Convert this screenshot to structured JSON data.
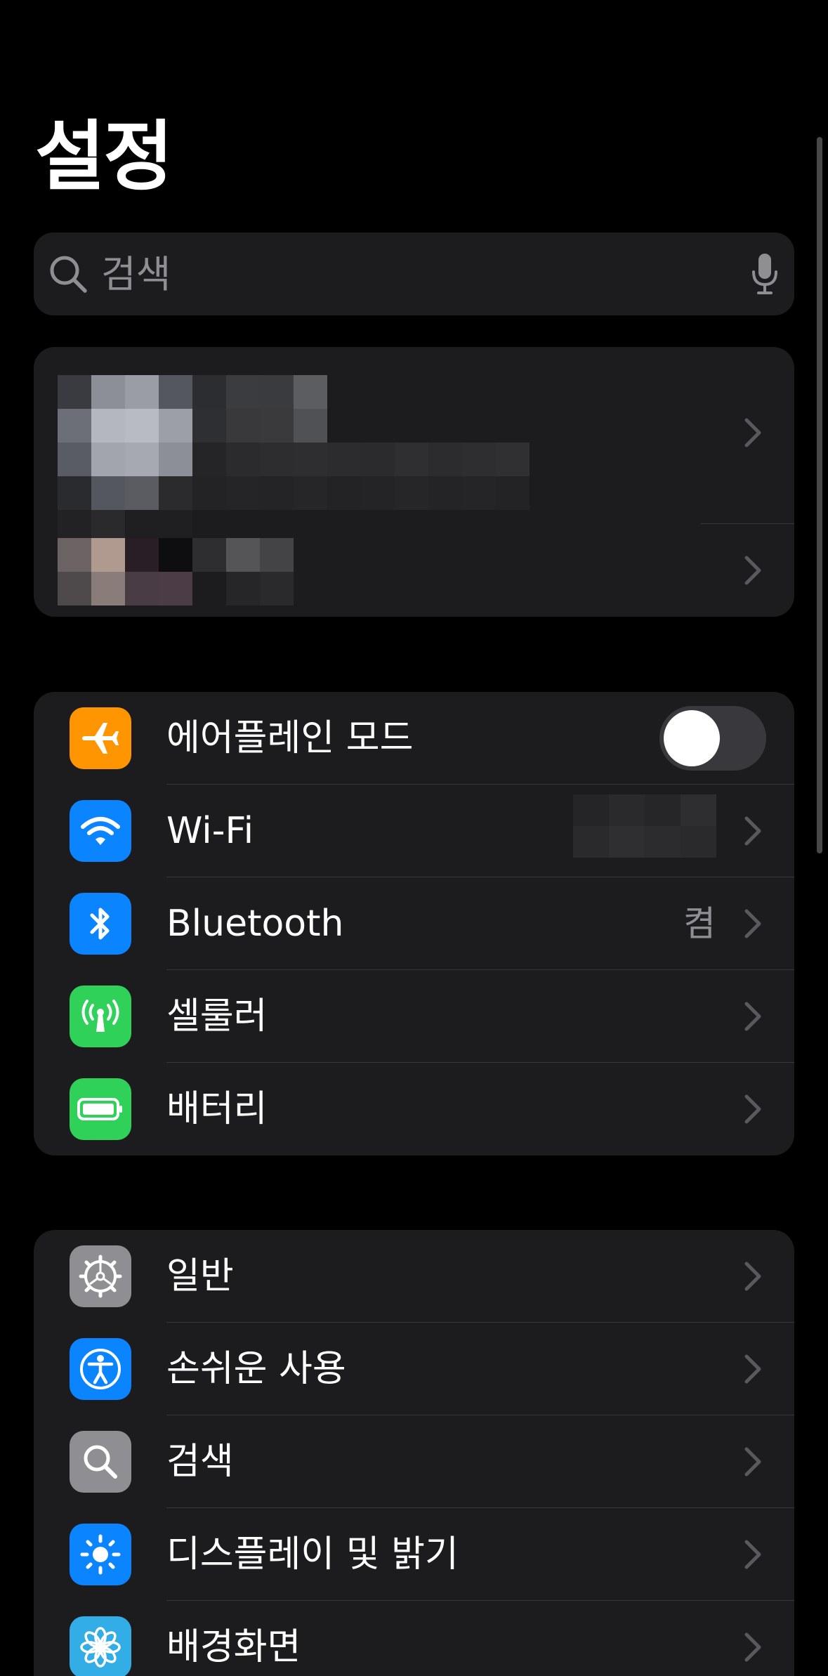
{
  "page": {
    "title": "설정"
  },
  "search": {
    "placeholder": "검색",
    "icon": "search-icon",
    "mic_icon": "microphone-icon"
  },
  "connectivity": {
    "items": [
      {
        "label": "에어플레인 모드",
        "icon": "airplane-icon",
        "icon_color": "#ff9500",
        "control": "toggle",
        "toggle_on": false
      },
      {
        "label": "Wi-Fi",
        "icon": "wifi-icon",
        "icon_color": "#0a84ff",
        "value_redacted": true
      },
      {
        "label": "Bluetooth",
        "icon": "bluetooth-icon",
        "icon_color": "#0a84ff",
        "value": "켬"
      },
      {
        "label": "셀룰러",
        "icon": "cellular-icon",
        "icon_color": "#30d158"
      },
      {
        "label": "배터리",
        "icon": "battery-icon",
        "icon_color": "#30d158"
      }
    ]
  },
  "general": {
    "items": [
      {
        "label": "일반",
        "icon": "gear-icon",
        "icon_color": "#8e8e93"
      },
      {
        "label": "손쉬운 사용",
        "icon": "accessibility-icon",
        "icon_color": "#0a84ff"
      },
      {
        "label": "검색",
        "icon": "search-icon",
        "icon_color": "#8e8e93"
      },
      {
        "label": "디스플레이 및 밝기",
        "icon": "sun-icon",
        "icon_color": "#0a84ff"
      },
      {
        "label": "배경화면",
        "icon": "wallpaper-flower-icon",
        "icon_color": "#32ade6"
      }
    ]
  },
  "colors": {
    "background": "#000000",
    "group_background": "#1c1c1e",
    "separator": "#38383a",
    "secondary_text": "#8e8e93",
    "chevron": "#5a5a5e",
    "toggle_off_track": "#39393d"
  }
}
